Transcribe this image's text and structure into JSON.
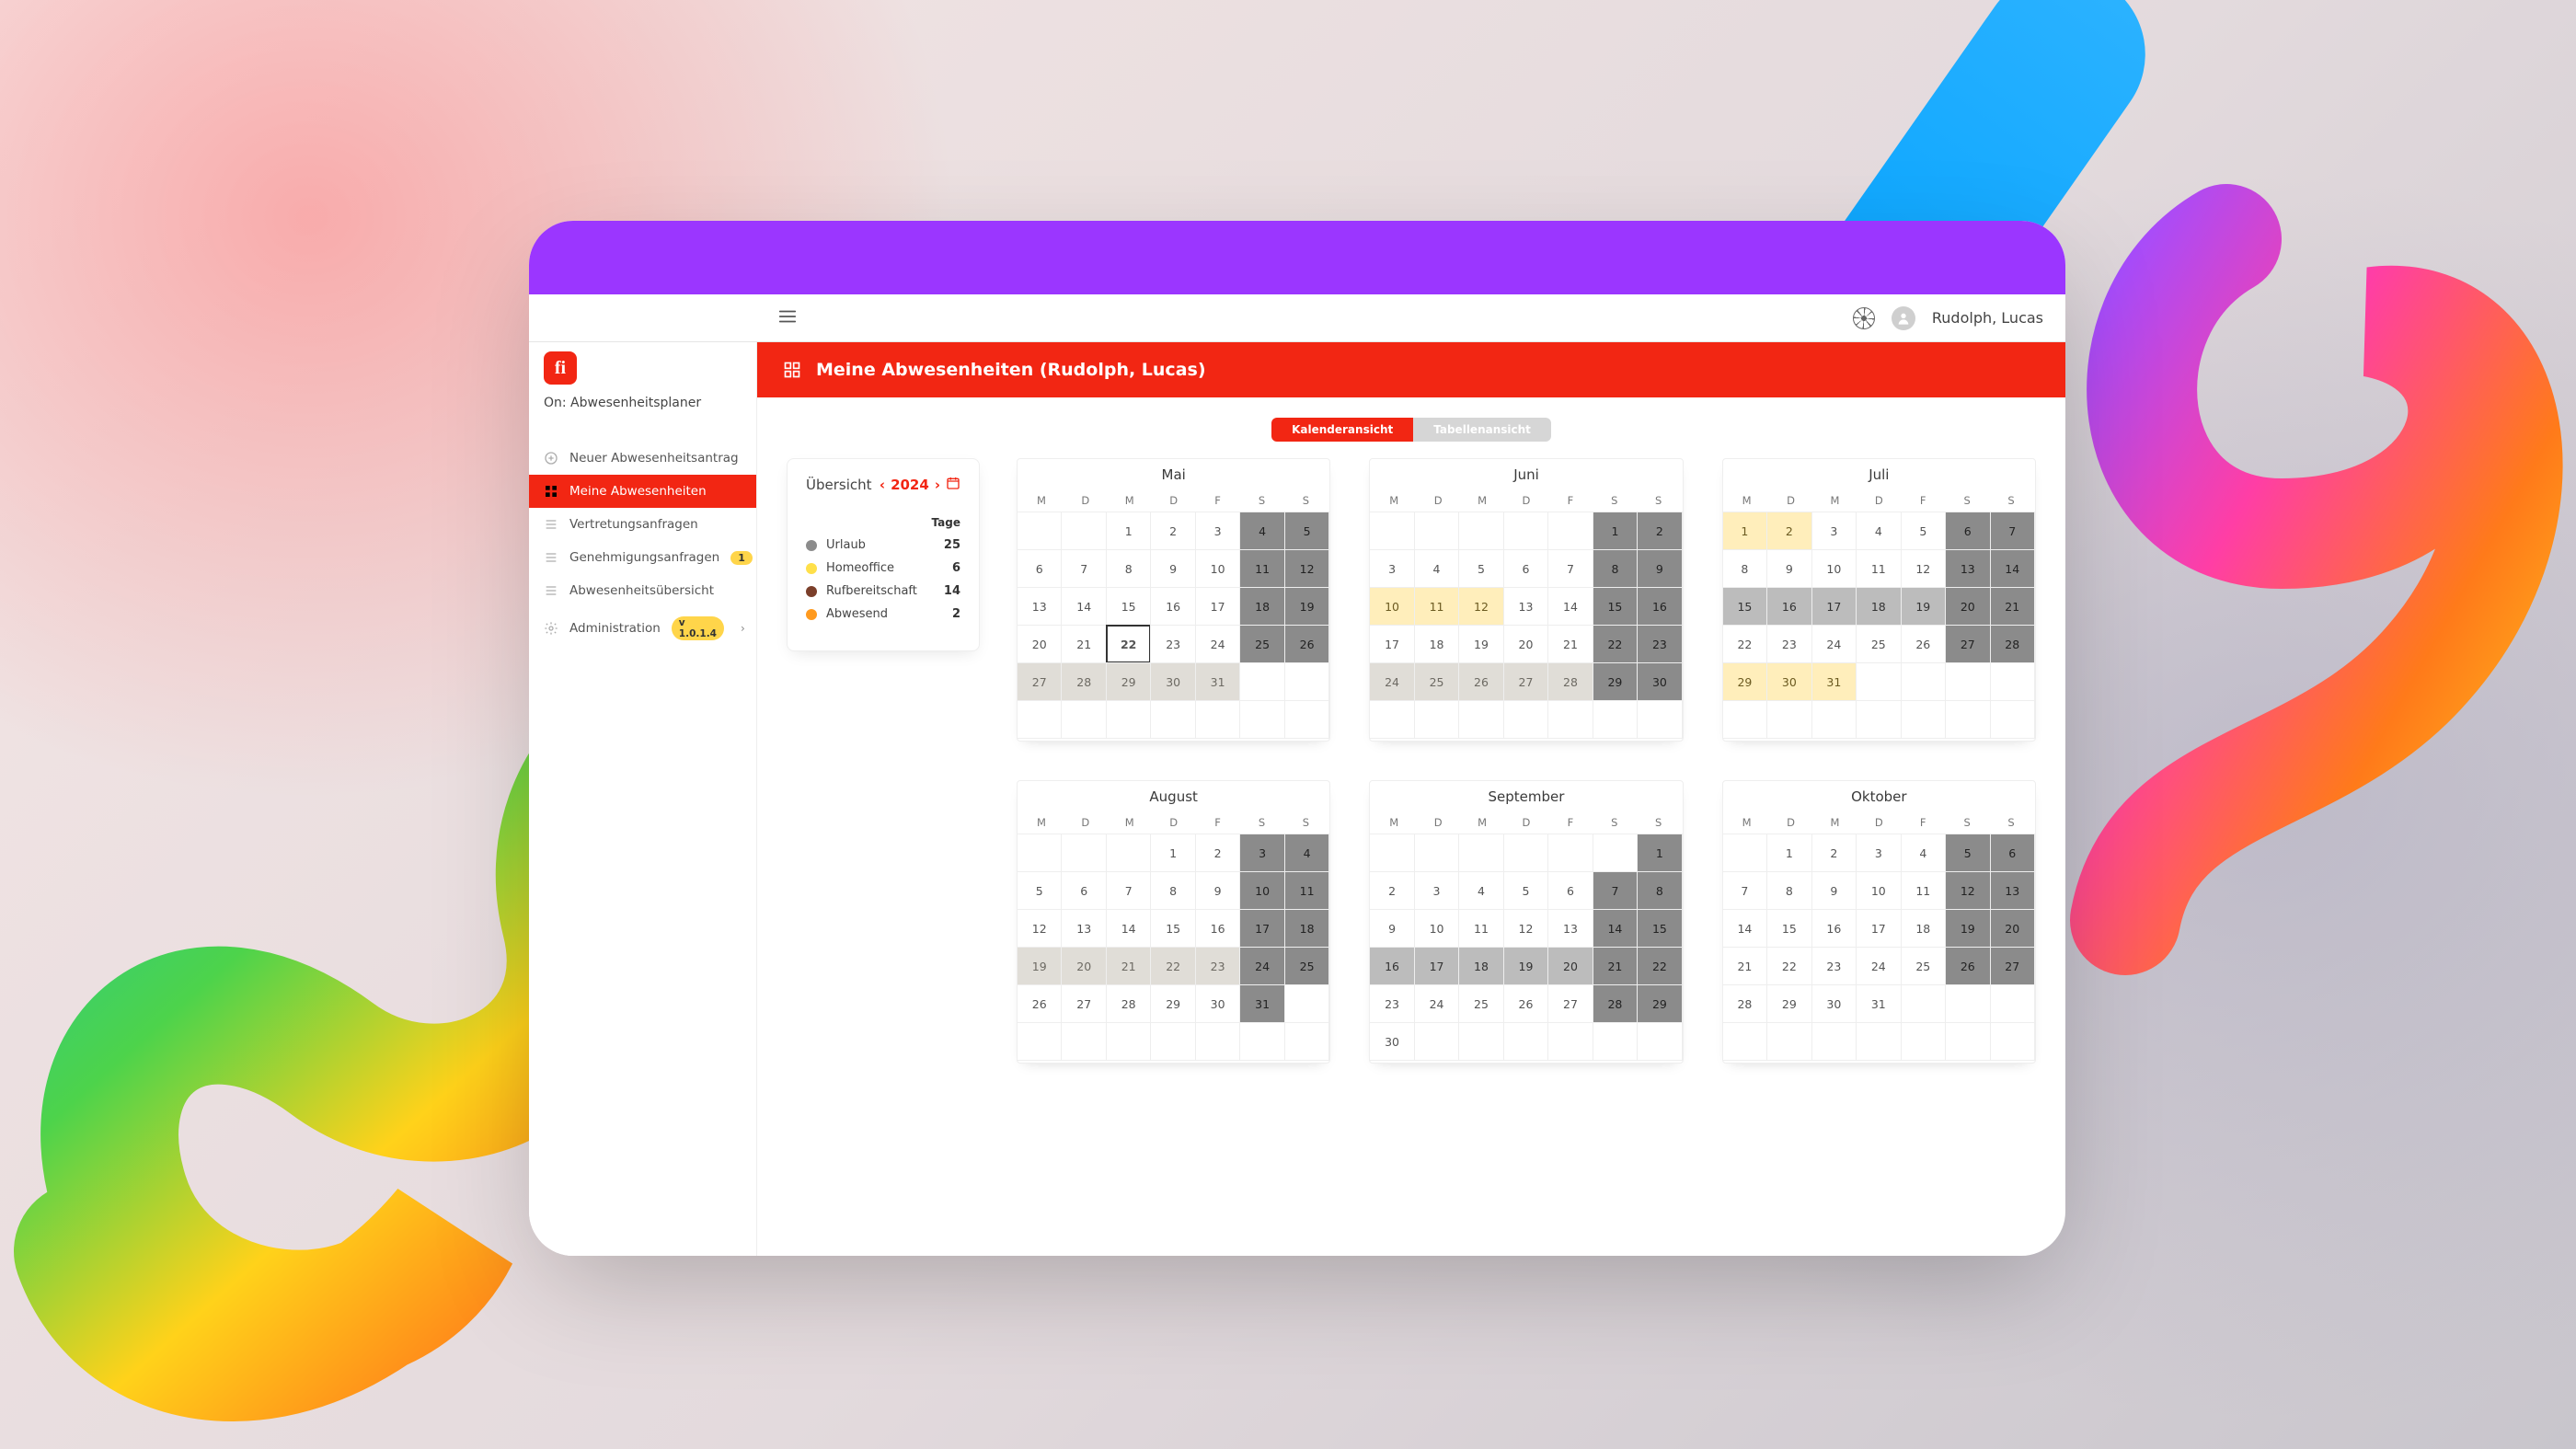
{
  "header": {
    "user_name": "Rudolph, Lucas"
  },
  "sidebar": {
    "brand_sub": "On: Abwesenheitsplaner",
    "items": [
      {
        "key": "new",
        "label": "Neuer Abwesenheitsantrag",
        "icon": "plus-circle"
      },
      {
        "key": "mine",
        "label": "Meine Abwesenheiten",
        "icon": "grid",
        "active": true
      },
      {
        "key": "vertret",
        "label": "Vertretungsanfragen",
        "icon": "list"
      },
      {
        "key": "approve",
        "label": "Genehmigungsanfragen",
        "icon": "list",
        "badge": "1"
      },
      {
        "key": "overview",
        "label": "Abwesenheitsübersicht",
        "icon": "list"
      },
      {
        "key": "admin",
        "label": "Administration",
        "icon": "gear",
        "pill": "v 1.0.1.4",
        "chevron": true
      }
    ]
  },
  "page": {
    "title": "Meine Abwesenheiten (Rudolph, Lucas)"
  },
  "view_switch": {
    "a": "Kalenderansicht",
    "b": "Tabellenansicht"
  },
  "overview": {
    "title": "Übersicht",
    "year": "2024",
    "days_label": "Tage",
    "rows": [
      {
        "label": "Urlaub",
        "value": "25",
        "color": "#8c8c8c"
      },
      {
        "label": "Homeoffice",
        "value": "6",
        "color": "#ffe04a"
      },
      {
        "label": "Rufbereitschaft",
        "value": "14",
        "color": "#7b3f2a"
      },
      {
        "label": "Abwesend",
        "value": "2",
        "color": "#ff9a1f"
      }
    ]
  },
  "dow": [
    "M",
    "D",
    "M",
    "D",
    "F",
    "S",
    "S"
  ],
  "months": [
    {
      "name": "Mai",
      "lead": 2,
      "days": 31,
      "today": 22,
      "cls": {
        "4": "weekend",
        "5": "weekend",
        "11": "weekend",
        "12": "weekend",
        "18": "weekend",
        "19": "weekend",
        "25": "weekend",
        "26": "weekend",
        "27": "soft",
        "28": "soft",
        "29": "soft",
        "30": "soft",
        "31": "soft"
      }
    },
    {
      "name": "Juni",
      "lead": 5,
      "days": 30,
      "cls": {
        "1": "weekend",
        "2": "weekend",
        "8": "weekend",
        "9": "weekend",
        "15": "weekend",
        "16": "weekend",
        "22": "weekend",
        "23": "weekend",
        "29": "weekend",
        "30": "weekend",
        "10": "holY",
        "11": "holY",
        "12": "holY",
        "24": "soft",
        "25": "soft",
        "26": "soft",
        "27": "soft",
        "28": "soft"
      }
    },
    {
      "name": "Juli",
      "lead": 0,
      "days": 31,
      "cls": {
        "6": "weekend",
        "7": "weekend",
        "13": "weekend",
        "14": "weekend",
        "20": "weekend",
        "21": "weekend",
        "27": "weekend",
        "28": "weekend",
        "1": "holY",
        "2": "holY",
        "15": "grey",
        "16": "grey",
        "17": "grey",
        "18": "grey",
        "19": "grey",
        "29": "holY",
        "30": "holY",
        "31": "holY"
      }
    },
    {
      "name": "August",
      "lead": 3,
      "days": 31,
      "cls": {
        "3": "weekend",
        "4": "weekend",
        "10": "weekend",
        "11": "weekend",
        "17": "weekend",
        "18": "weekend",
        "24": "weekend",
        "25": "weekend",
        "31": "weekend",
        "19": "soft",
        "20": "soft",
        "21": "soft",
        "22": "soft",
        "23": "soft"
      }
    },
    {
      "name": "September",
      "lead": 6,
      "days": 30,
      "cls": {
        "1": "weekend",
        "7": "weekend",
        "8": "weekend",
        "14": "weekend",
        "15": "weekend",
        "21": "weekend",
        "22": "weekend",
        "28": "weekend",
        "29": "weekend",
        "16": "grey",
        "17": "grey",
        "18": "grey",
        "19": "grey",
        "20": "grey"
      }
    },
    {
      "name": "Oktober",
      "lead": 1,
      "days": 31,
      "cls": {
        "5": "weekend",
        "6": "weekend",
        "12": "weekend",
        "13": "weekend",
        "19": "weekend",
        "20": "weekend",
        "26": "weekend",
        "27": "weekend"
      }
    }
  ],
  "colors": {
    "accent": "#f22613",
    "purple": "#9b36ff"
  }
}
